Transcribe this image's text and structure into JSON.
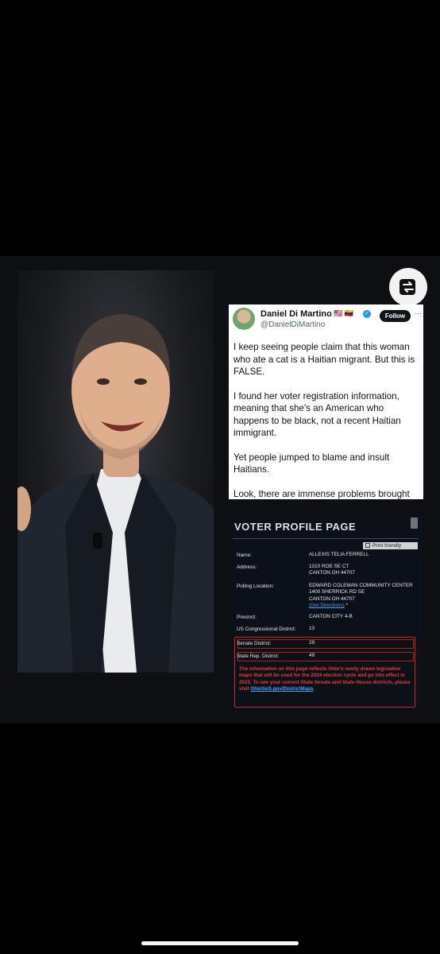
{
  "tweet": {
    "author_name": "Daniel Di Martino",
    "author_flags": "🇺🇸 🇻🇪",
    "author_handle": "@DanielDiMartino",
    "follow_label": "Follow",
    "more_label": "···",
    "paragraphs": [
      "I keep seeing people claim that this woman who ate a cat is a Haitian migrant. But this is FALSE.",
      "I found her voter registration information, meaning that she's an American who happens to be black,  not a recent Haitian immigrant.",
      "Yet people jumped to blame and insult Haitians.",
      "Look, there are immense problems brought by illegal migration, but calling a national origin"
    ]
  },
  "voter_page": {
    "title": "VOTER PROFILE PAGE",
    "print_label": "Print friendly",
    "rows": [
      {
        "label": "Name:",
        "lines": [
          "ALLEXIS TELIA FERRELL"
        ]
      },
      {
        "label": "Address:",
        "lines": [
          "1310 ROE SE CT",
          "CANTON OH 44707"
        ]
      },
      {
        "label": "Polling Location:",
        "lines": [
          "EDWARD COLEMAN COMMUNITY CENTER",
          "1400 SHERRICK RD SE",
          "CANTON OH 44707"
        ],
        "link": "(Get Directions)",
        "link_suffix": " *"
      },
      {
        "label": "Precinct:",
        "lines": [
          "CANTON CITY 4-B"
        ]
      },
      {
        "label": "US Congressional District:",
        "lines": [
          "13"
        ]
      },
      {
        "label": "Senate District:",
        "lines": [
          "29"
        ]
      },
      {
        "label": "State Rep. District:",
        "lines": [
          "49"
        ]
      }
    ],
    "notice": "The information on this page reflects Ohio's newly drawn legislative maps that will be used for the 2024 election cycle and go into effect in 2025. To see your current State Senate and State House districts, please visit",
    "notice_link": "OhioSoS.gov/DistrictMaps",
    "notice_end": "."
  },
  "icons": {
    "switch": "switch-arrows-icon",
    "verified": "verified-badge-icon"
  },
  "colors": {
    "background": "#000000",
    "panel": "#0d0f12",
    "twitter_blue": "#1d9bf0",
    "notice_red": "#e8393b",
    "link_blue": "#4d9fff"
  }
}
